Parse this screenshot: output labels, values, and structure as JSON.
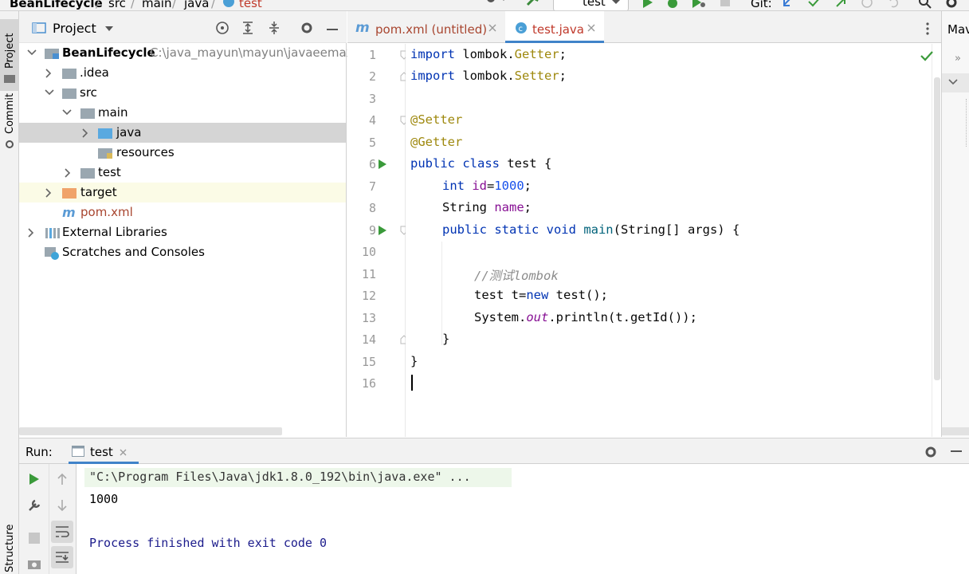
{
  "breadcrumb": {
    "project": "BeanLifecycle",
    "items": [
      "src",
      "main",
      "java"
    ],
    "file": "test"
  },
  "toolbar": {
    "run_config": "test",
    "git_label": "Git:"
  },
  "left_stripe": {
    "project_tab": "Project",
    "commit_tab": "Commit",
    "structure_tab": "Structure"
  },
  "project_panel": {
    "title": "Project",
    "root_name": "BeanLifecycle",
    "root_path": "C:\\java_mayun\\mayun\\javaeemax\\",
    "nodes": [
      ".idea",
      "src",
      "main",
      "java",
      "resources",
      "test",
      "target",
      "pom.xml",
      "External Libraries",
      "Scratches and Consoles"
    ]
  },
  "editor": {
    "tabs": [
      {
        "label": "pom.xml (untitled)"
      },
      {
        "label": "test.java"
      }
    ],
    "line_numbers": [
      "1",
      "2",
      "3",
      "4",
      "5",
      "6",
      "7",
      "8",
      "9",
      "10",
      "11",
      "12",
      "13",
      "14",
      "15",
      "16"
    ],
    "code": {
      "l1_kw": "import",
      "l1_pkg": " lombok.",
      "l1_cls": "Getter",
      "l1_end": ";",
      "l2_kw": "import",
      "l2_pkg": " lombok.",
      "l2_cls": "Setter",
      "l2_end": ";",
      "l4_ann": "@Setter",
      "l5_ann": "@Getter",
      "l6_kw": "public class",
      "l6_rest": " test {",
      "l7_kw": "int",
      "l7_fld": " id",
      "l7_eq": "=",
      "l7_num": "1000",
      "l7_end": ";",
      "l8_type": "String",
      "l8_fld": " name",
      "l8_end": ";",
      "l9_kw": "public static void",
      "l9_fn": " main",
      "l9_rest": "(String[] args) {",
      "l11_cmt": "//测试lombok",
      "l12_a": "test t=",
      "l12_kw": "new",
      "l12_b": " test();",
      "l13_a": "System.",
      "l13_out": "out",
      "l13_b": ".println(t.getId());",
      "l14": "}",
      "l15": "}"
    }
  },
  "right_panel": {
    "label": "Mav"
  },
  "run_panel": {
    "label": "Run:",
    "tab": "test",
    "console": [
      "\"C:\\Program Files\\Java\\jdk1.8.0_192\\bin\\java.exe\" ...",
      "1000",
      "",
      "Process finished with exit code 0"
    ]
  },
  "colors": {
    "accent": "#2e7d32",
    "keyword": "#0033b3",
    "annotation": "#9e880d",
    "number": "#1750eb",
    "console_blue": "#1c1c8c"
  }
}
